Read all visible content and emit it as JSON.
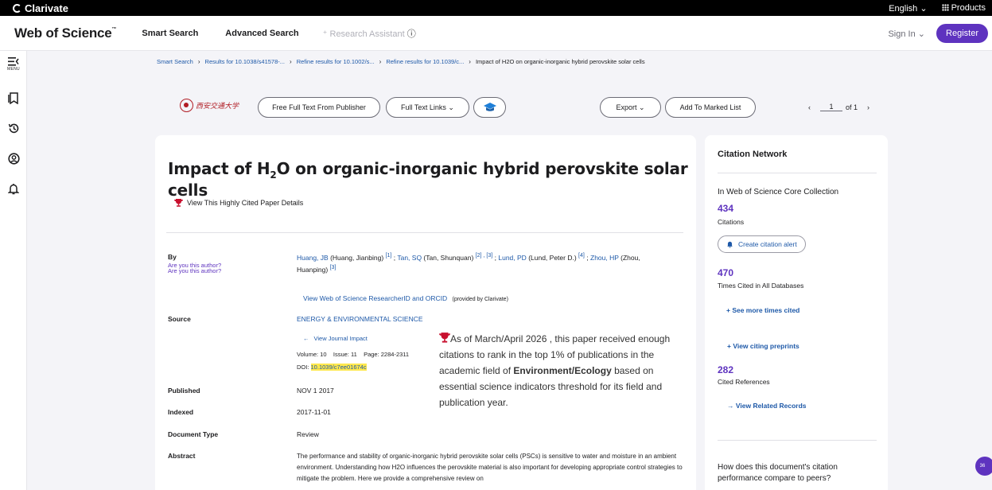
{
  "topbar": {
    "brand": "Clarivate",
    "language": "English ⌄",
    "products": "Products"
  },
  "header": {
    "logo": "Web of Science",
    "logo_tm": "™",
    "nav": [
      "Smart Search",
      "Advanced Search",
      "Research Assistant"
    ],
    "sign_in": "Sign In ⌄",
    "register": "Register"
  },
  "rail": {
    "menu_label": "MENU"
  },
  "breadcrumb": [
    "Smart Search",
    "Results for 10.1038/s41578-...",
    "Refine results for 10.1002/s...",
    "Refine results for 10.1039/c...",
    "Impact of H2O on organic-inorganic hybrid perovskite solar cells"
  ],
  "actions": {
    "institution_logo_text": "西安交通大学",
    "free_full_text": "Free Full Text From Publisher",
    "full_text_links": "Full Text Links ⌄",
    "export": "Export ⌄",
    "add_to_marked": "Add To Marked List",
    "page_current": "1",
    "page_total": "of 1"
  },
  "record": {
    "title_pre": "Impact of H",
    "title_sub": "2",
    "title_post": "O on organic-inorganic hybrid perovskite solar cells",
    "highly_cited_link": "View This Highly Cited Paper Details",
    "by_label": "By",
    "author_prompt_1": "Are you this author?",
    "author_prompt_2": "Are you this author?",
    "authors_line1": {
      "a1": "Huang, JB",
      "a1_full": " (Huang, Jianbing) ",
      "a1_ref": "[1]",
      "sep1": " ; ",
      "a2": "Tan, SQ",
      "a2_full": " (Tan, Shunquan) ",
      "a2_ref": "[2] , [3]",
      "sep2": " ; ",
      "a3": "Lund, PD",
      "a3_full": " (Lund, Peter D.) ",
      "a3_ref": "[4]",
      "sep3": " ; ",
      "a4": "Zhou, HP",
      "a4_full": " (Zhou,"
    },
    "authors_line2": {
      "text": "Huanping) ",
      "ref": "[3]"
    },
    "researcherid_link": "View Web of Science ResearcherID and ORCID",
    "researcherid_note": "(provided by Clarivate)",
    "source_label": "Source",
    "source_value": "ENERGY & ENVIRONMENTAL SCIENCE",
    "journal_impact": "View Journal Impact",
    "volume_line": "Volume: 10    Issue: 11    Page: 2284-2311",
    "doi_label": "DOI: ",
    "doi_value": "10.1039/c7ee01674c",
    "published_label": "Published",
    "published_value": "NOV 1 2017",
    "indexed_label": "Indexed",
    "indexed_value": "2017-11-01",
    "doctype_label": "Document Type",
    "doctype_value": "Review",
    "abstract_label": "Abstract",
    "abstract_value": "The performance and stability of organic-inorganic hybrid perovskite solar cells (PSCs) is sensitive to water and moisture in an ambient environment. Understanding how H2O influences the perovskite material is also important for developing appropriate control strategies to mitigate the problem. Here we provide a comprehensive review on"
  },
  "callout": {
    "pre": "As of March/April 2026 , this paper received enough citations to rank in the top 1% of publications in the academic field of ",
    "field": "Environment/Ecology",
    "post": " based on essential science indicators threshold for its field and publication year."
  },
  "citation_network": {
    "title": "Citation Network",
    "collection": "In Web of Science Core Collection",
    "citations_count": "434",
    "citations_label": "Citations",
    "create_alert": "Create citation alert",
    "times_cited_count": "470",
    "times_cited_label": "Times Cited in All Databases",
    "see_more": "+ See more times cited",
    "citing_preprints": "+ View citing preprints",
    "cited_refs_count": "282",
    "cited_refs_label": "Cited References",
    "related_records": "→ View Related Records",
    "compare_question": "How does this document's citation performance compare to peers?"
  },
  "badge": {
    "count": "36"
  },
  "colors": {
    "accent": "#5e33bf",
    "link": "#1e59a8",
    "highlight": "#ffe84d"
  }
}
